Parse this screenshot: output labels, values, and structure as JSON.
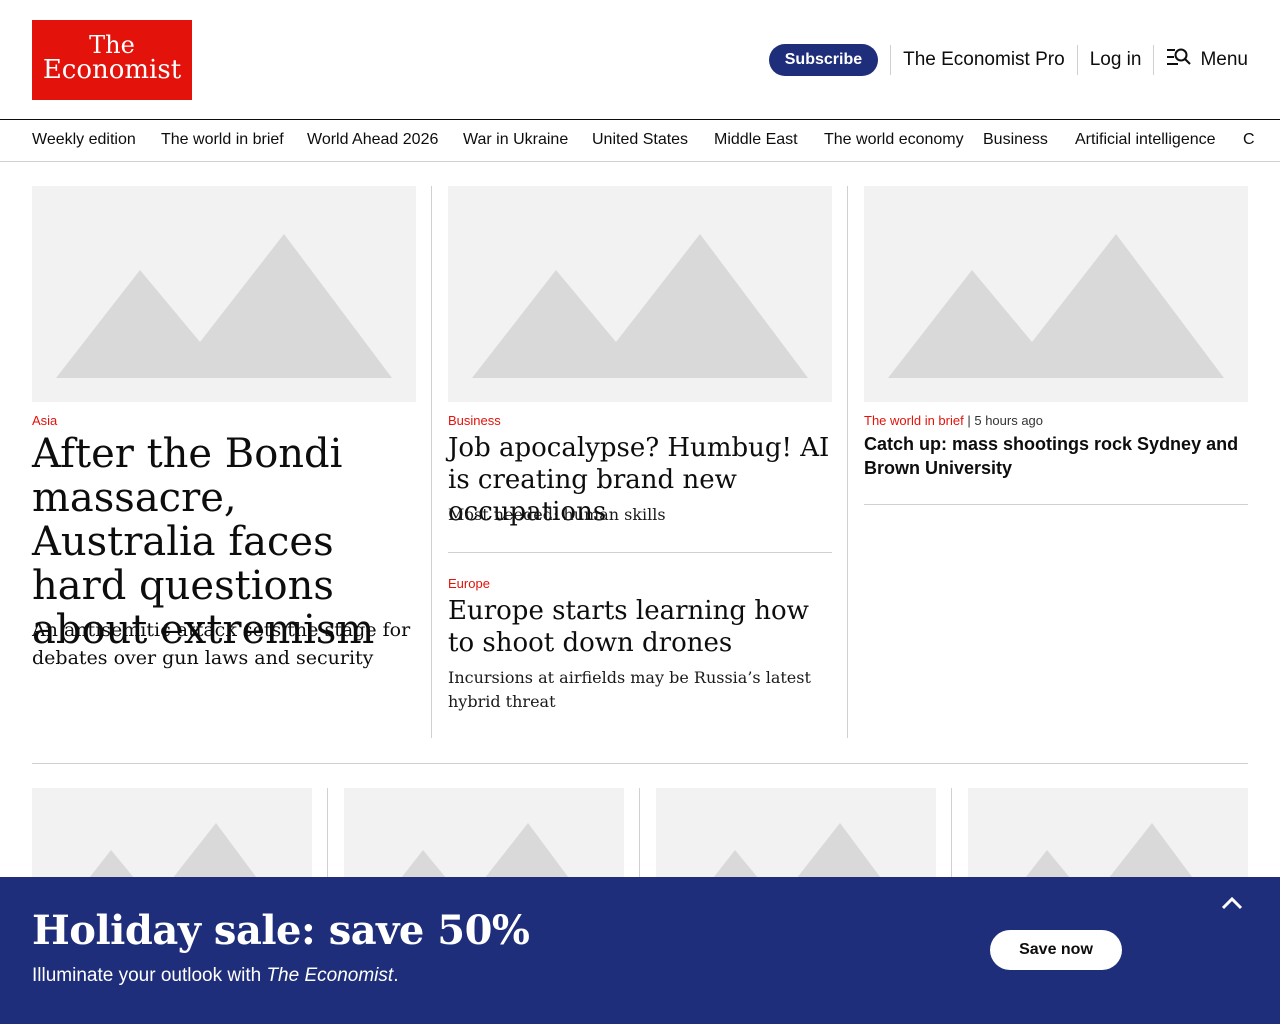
{
  "header": {
    "logo": {
      "line1": "The",
      "line2": "Economist"
    },
    "subscribe": "Subscribe",
    "pro": "The Economist Pro",
    "login": "Log in",
    "menu": "Menu",
    "menu_icon": "search-menu-icon"
  },
  "nav": [
    "Weekly edition",
    "The world in brief",
    "World Ahead 2026",
    "War in Ukraine",
    "United States",
    "Middle East",
    "The world economy",
    "Business",
    "Artificial intelligence",
    "C"
  ],
  "articles": {
    "lead": {
      "kicker": "Asia",
      "headline": "After the Bondi massacre, Australia faces hard questions about extremism",
      "description": "An antisemitic attack sets the stage for debates over gun laws and security"
    },
    "second": {
      "kicker": "Business",
      "headline": "Job apocalypse? Humbug! AI is creating brand new occupations",
      "description": "Most needed: human skills"
    },
    "third": {
      "kicker": "Europe",
      "headline": "Europe starts learning how to shoot down drones",
      "description": "Incursions at airfields may be Russia’s latest hybrid threat"
    },
    "brief": {
      "kicker": "The world in brief",
      "separator": "|",
      "time": "5 hours ago",
      "headline": "Catch up: mass shootings rock Sydney and Brown University"
    }
  },
  "banner": {
    "title": "Holiday sale: save 50%",
    "subtitle_prefix": "Illuminate your outlook with ",
    "subtitle_em": "The Economist",
    "subtitle_suffix": ".",
    "button": "Save now",
    "collapse_icon": "chevron-up-icon"
  },
  "colors": {
    "brand_red": "#e3120b",
    "navy": "#1f2e7a",
    "placeholder_bg": "#f2f2f2",
    "placeholder_shape": "#d9d9d9"
  }
}
